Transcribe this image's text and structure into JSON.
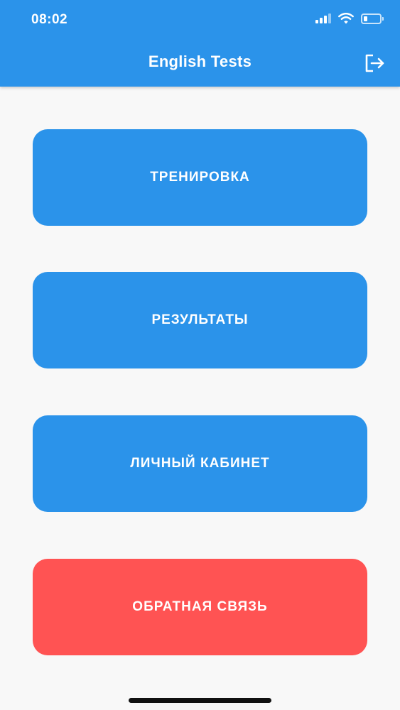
{
  "status_bar": {
    "time": "08:02",
    "icons": [
      "signal-icon",
      "wifi-icon",
      "battery-icon"
    ],
    "battery_level": 0.25
  },
  "header": {
    "title": "English Tests",
    "action_icon": "logout-icon",
    "background_color": "#2B93EA"
  },
  "menu": {
    "training_label": "ТРЕНИРОВКА",
    "results_label": "РЕЗУЛЬТАТЫ",
    "profile_label": "ЛИЧНЫЙ КАБИНЕТ",
    "feedback_label": "ОБРАТНАЯ СВЯЗЬ"
  },
  "colors": {
    "primary": "#2B93EA",
    "danger": "#FF5353",
    "background": "#F8F8F8",
    "button_text": "#FFFFFF"
  }
}
